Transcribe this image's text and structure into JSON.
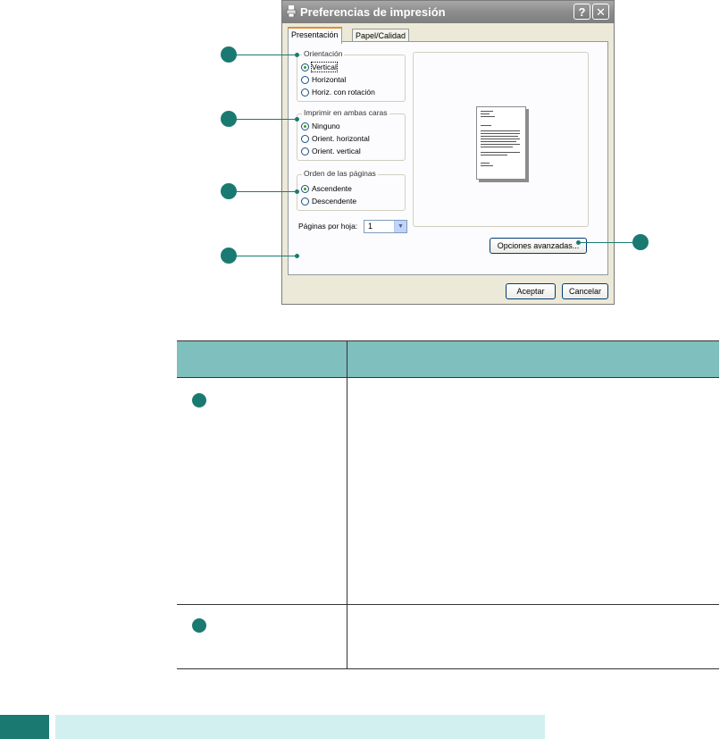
{
  "dialog": {
    "title": "Preferencias de impresión",
    "help_glyph": "?",
    "close_glyph": "✕",
    "app_icon": "printer-icon",
    "tabs": [
      {
        "label": "Presentación",
        "active": true
      },
      {
        "label": "Papel/Calidad",
        "active": false
      }
    ],
    "orientation": {
      "legend": "Orientación",
      "options": [
        {
          "label": "Vertical",
          "selected": true
        },
        {
          "label": "Horizontal",
          "selected": false
        },
        {
          "label": "Horiz. con rotación",
          "selected": false
        }
      ]
    },
    "duplex": {
      "legend": "Imprimir en ambas caras",
      "options": [
        {
          "label": "Ninguno",
          "selected": true
        },
        {
          "label": "Orient. horizontal",
          "selected": false
        },
        {
          "label": "Orient. vertical",
          "selected": false
        }
      ]
    },
    "page_order": {
      "legend": "Orden de las páginas",
      "options": [
        {
          "label": "Ascendente",
          "selected": true
        },
        {
          "label": "Descendente",
          "selected": false
        }
      ]
    },
    "pages_per_sheet": {
      "label": "Páginas por hoja:",
      "value": "1",
      "arrow_glyph": "▼"
    },
    "advanced_button": "Opciones avanzadas...",
    "accept_button": "Aceptar",
    "cancel_button": "Cancelar"
  },
  "colors": {
    "callout": "#1A7A72",
    "table_header": "#7FBFBD",
    "footer_dark": "#1A7A72",
    "footer_light": "#D2F0F0"
  }
}
